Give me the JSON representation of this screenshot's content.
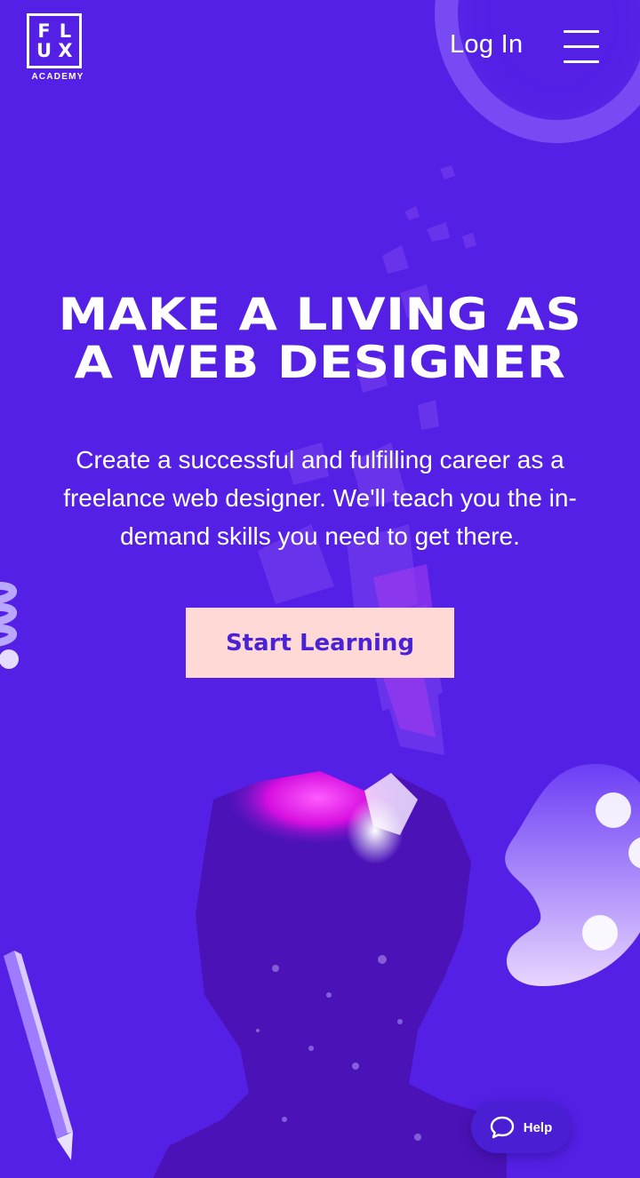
{
  "header": {
    "logo_letters": [
      "F",
      "L",
      "U",
      "X"
    ],
    "logo_subtitle": "ACADEMY",
    "login_label": "Log In",
    "menu_icon": "hamburger-icon"
  },
  "hero": {
    "headline_line1": "MAKE A LIVING AS",
    "headline_line2": "A WEB DESIGNER",
    "subtext": "Create a successful and fulfilling career as a freelance web designer. We'll teach you the in-demand skills you need to get there.",
    "cta_label": "Start Learning"
  },
  "help_widget": {
    "label": "Help",
    "icon": "chat-bubble-icon"
  },
  "colors": {
    "background": "#5420e6",
    "cta_background": "#ffd9d6",
    "cta_text": "#4a22d6",
    "accent_magenta": "#e60fe6"
  }
}
